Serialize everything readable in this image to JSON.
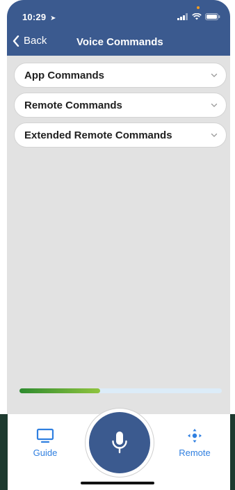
{
  "status_bar": {
    "time": "10:29"
  },
  "nav": {
    "back_label": "Back",
    "title": "Voice Commands"
  },
  "sections": [
    {
      "label": "App Commands"
    },
    {
      "label": "Remote Commands"
    },
    {
      "label": "Extended Remote Commands"
    }
  ],
  "progress": {
    "fraction": 0.4
  },
  "tabs": {
    "guide_label": "Guide",
    "remote_label": "Remote"
  },
  "colors": {
    "header": "#3b5a8f",
    "accent": "#2f7fe0",
    "content_bg": "#e2e2e2",
    "progress_fill": "#4fa534"
  },
  "icons": [
    "location-arrow-icon",
    "signal-icon",
    "wifi-icon",
    "battery-icon",
    "chevron-left-icon",
    "chevron-down-icon",
    "tv-icon",
    "microphone-icon",
    "dpad-icon"
  ]
}
